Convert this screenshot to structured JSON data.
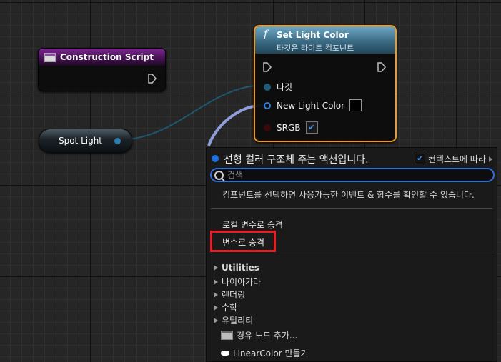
{
  "nodes": {
    "construction_script": {
      "title": "Construction Script"
    },
    "spot_light": {
      "label": "Spot Light"
    },
    "set_light_color": {
      "title": "Set Light Color",
      "subtitle": "타깃은 라이트 컴포넌트",
      "pins": {
        "target": "타깃",
        "new_light_color": "New Light Color",
        "srgb": "SRGB"
      },
      "srgb_checked": true
    }
  },
  "context_menu": {
    "title": "선형 컬러 구조체 주는 액션입니다.",
    "context_sensitive_label": "컨텍스트에 따라",
    "context_sensitive_checked": true,
    "search_placeholder": "검색",
    "hint": "컴포넌트를 선택하면 사용가능한 이벤트 & 함수를 확인할 수 있습니다.",
    "promote_local": "로컬 변수로 승격",
    "promote_variable": "변수로 승격",
    "categories": [
      "Utilities",
      "나이아가라",
      "렌더링",
      "수학",
      "유틸리티"
    ],
    "actions": {
      "add_reroute": "경유 노드 추가...",
      "make_linear_color": "LinearColor 만들기"
    }
  },
  "colors": {
    "selection_outline": "#f29a1c",
    "highlight_box": "#e51e25",
    "accent_blue": "#2f6fd4",
    "construction_header": "#7b2791",
    "function_header": "#3b6b85"
  }
}
